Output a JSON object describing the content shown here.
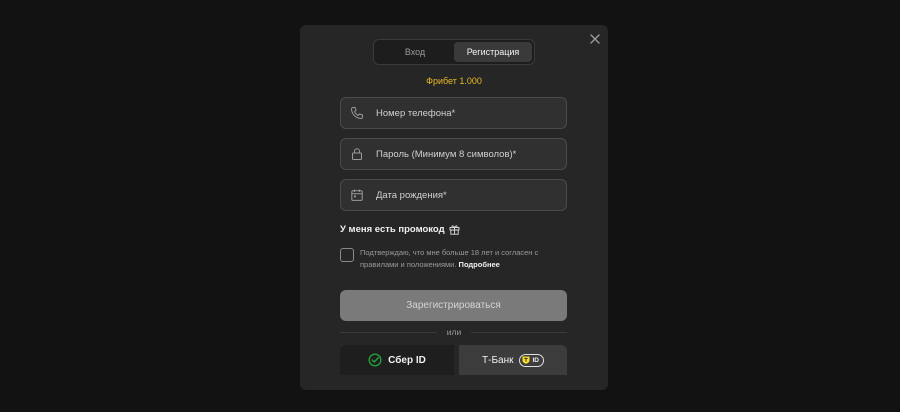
{
  "modal": {
    "tabs": [
      {
        "label": "Вход",
        "active": false
      },
      {
        "label": "Регистрация",
        "active": true
      }
    ],
    "freebet": "Фрибет 1.000",
    "fields": {
      "phone": {
        "placeholder": "Номер телефона*",
        "icon": "phone-icon"
      },
      "password": {
        "placeholder": "Пароль (Минимум 8 символов)*",
        "icon": "lock-icon"
      },
      "birthdate": {
        "placeholder": "Дата рождения*",
        "icon": "calendar-icon"
      }
    },
    "promo_label": "У меня есть промокод",
    "consent_text": "Подтверждаю, что мне больше 18 лет и согласен с правилами и положениями.",
    "consent_more": "Подробнее",
    "register_label": "Зарегистрироваться",
    "divider_label": "или",
    "social": {
      "sber_label": "Сбер ID",
      "tbank_label": "Т-Банк",
      "tbank_badge": "ID"
    }
  },
  "colors": {
    "accent_gold": "#e8b923",
    "sber_green": "#21a038",
    "tbank_yellow": "#ffdd2d"
  }
}
